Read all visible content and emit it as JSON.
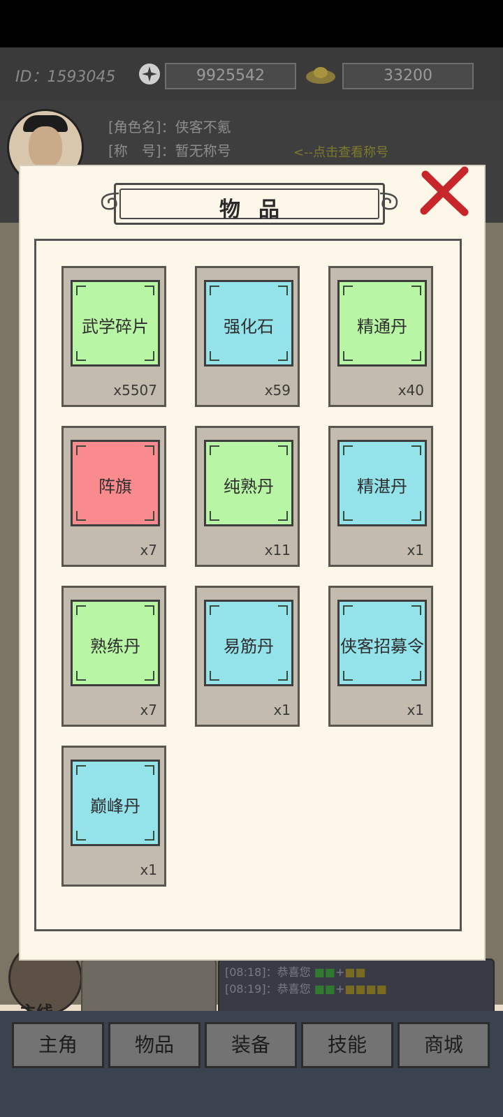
{
  "header": {
    "id_text": "ID：1593045",
    "currency1": "9925542",
    "currency2": "33200"
  },
  "profile": {
    "name_line": "[角色名]：侠客不氪",
    "title_line": "[称　号]：暂无称号",
    "title_hint": "<--点击查看称号"
  },
  "chat": [
    {
      "time": "[08:18]：",
      "text": "恭喜您"
    },
    {
      "time": "[08:19]：",
      "text": "恭喜您"
    }
  ],
  "zhu_label": "主线",
  "nav": [
    "主角",
    "物品",
    "装备",
    "技能",
    "商城"
  ],
  "modal": {
    "title": "物品",
    "items": [
      {
        "name": "武学碎片",
        "count": "x5507",
        "color": "#b8f5a4"
      },
      {
        "name": "强化石",
        "count": "x59",
        "color": "#94e2ea"
      },
      {
        "name": "精通丹",
        "count": "x40",
        "color": "#b8f5a4"
      },
      {
        "name": "阵旗",
        "count": "x7",
        "color": "#f98a8e"
      },
      {
        "name": "纯熟丹",
        "count": "x11",
        "color": "#b8f5a4"
      },
      {
        "name": "精湛丹",
        "count": "x1",
        "color": "#94e2ea"
      },
      {
        "name": "熟练丹",
        "count": "x7",
        "color": "#b8f5a4"
      },
      {
        "name": "易筋丹",
        "count": "x1",
        "color": "#94e2ea"
      },
      {
        "name": "侠客招募令",
        "count": "x1",
        "color": "#94e2ea"
      },
      {
        "name": "巅峰丹",
        "count": "x1",
        "color": "#94e2ea"
      }
    ]
  }
}
